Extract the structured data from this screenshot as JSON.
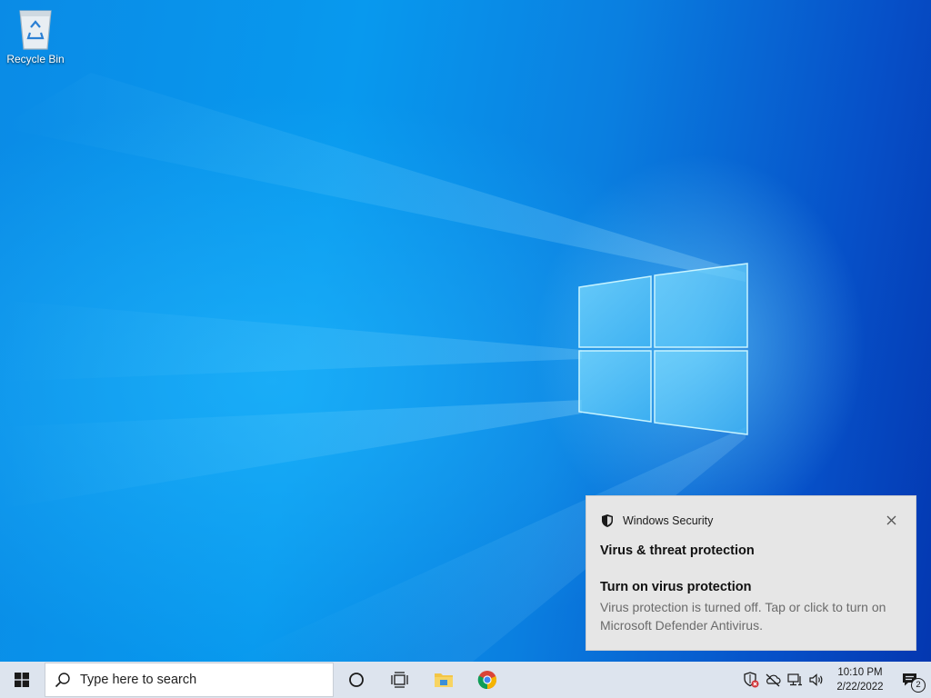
{
  "desktop": {
    "icons": [
      {
        "label": "Recycle Bin",
        "icon": "recycle-bin-icon"
      }
    ]
  },
  "toast": {
    "app_name": "Windows Security",
    "app_icon": "shield-icon",
    "title": "Virus & threat protection",
    "subtitle": "Turn on virus protection",
    "body": "Virus protection is turned off. Tap or click to turn on Microsoft Defender Antivirus.",
    "close_icon": "close-icon"
  },
  "taskbar": {
    "start_icon": "windows-start-icon",
    "search_placeholder": "Type here to search",
    "pinned": [
      {
        "name": "cortana",
        "icon": "cortana-circle-icon"
      },
      {
        "name": "task-view",
        "icon": "task-view-icon"
      },
      {
        "name": "file-explorer",
        "icon": "folder-icon"
      },
      {
        "name": "chrome",
        "icon": "chrome-icon"
      }
    ],
    "tray": [
      {
        "icon": "security-warning-icon"
      },
      {
        "icon": "onedrive-off-icon"
      },
      {
        "icon": "network-icon"
      },
      {
        "icon": "volume-icon"
      }
    ],
    "clock": {
      "time": "10:10 PM",
      "date": "2/22/2022"
    },
    "notifications": {
      "icon": "action-center-icon",
      "count": "2"
    }
  },
  "colors": {
    "taskbar_bg": "#dde4ee",
    "toast_bg": "#e6e6e6",
    "desktop_blue": "#0a8be6"
  }
}
